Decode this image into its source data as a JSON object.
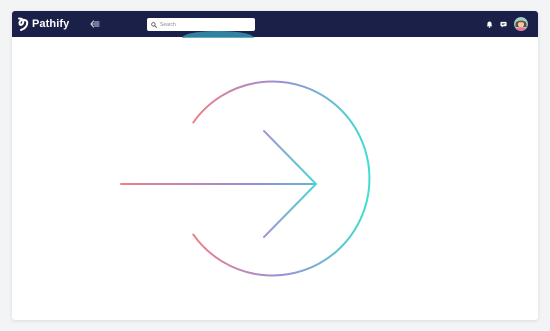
{
  "app": {
    "brand_name": "Pathify"
  },
  "navbar": {
    "collapse_icon": "collapse-sidebar-icon",
    "search": {
      "placeholder": "Search",
      "icon": "search-icon"
    },
    "icons": [
      "bell-icon",
      "chat-icon",
      "avatar"
    ]
  },
  "main": {
    "illustration_icon": "arrow-right-circle-icon"
  },
  "colors": {
    "navbar_bg": "#1b2049",
    "gradient_start": "#f07f86",
    "gradient_mid": "#8f90d8",
    "gradient_end": "#3ce0d0"
  }
}
